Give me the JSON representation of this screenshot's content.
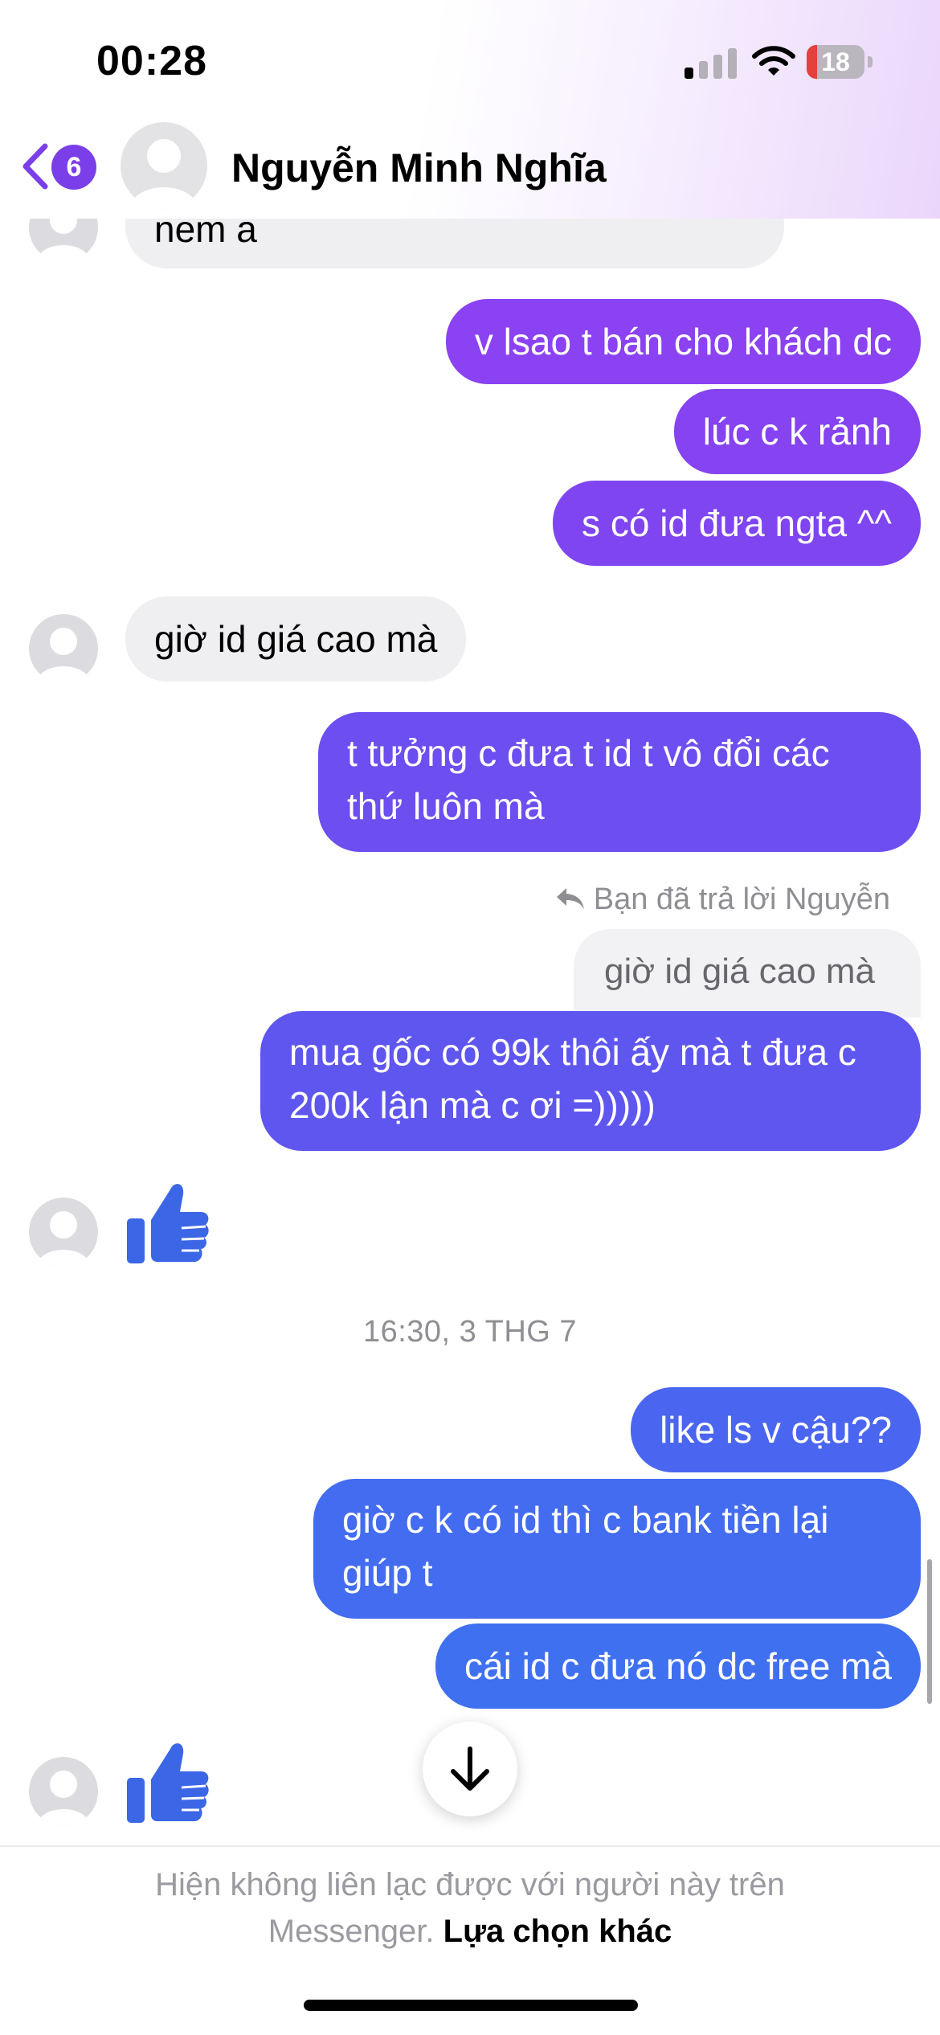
{
  "status_bar": {
    "time": "00:28",
    "battery_level": "18",
    "battery_fraction": 0.18
  },
  "header": {
    "back_badge_count": "6",
    "contact_name": "Nguyễn Minh Nghĩa"
  },
  "messages": {
    "m0_in_partial": "nem a",
    "m1_out": "v lsao t bán cho khách dc",
    "m2_out": "lúc c k rảnh",
    "m3_out": "s có id đưa ngta ^^",
    "m4_in": "giờ id giá cao mà",
    "m5_out": "t tưởng c đưa t id t vô đổi các thứ luôn mà",
    "reply_label": "Bạn đã trả lời Nguyễn",
    "reply_quote": "giờ id giá cao mà",
    "m6_out": "mua gốc có 99k thôi ấy mà t đưa c 200k lận mà c ơi =)))))",
    "timestamp": "16:30, 3 THG 7",
    "m7_out": "like ls v cậu??",
    "m8_out": "giờ c k có id thì c bank tiền lại giúp t",
    "m9_out": "cái id c đưa nó dc free mà"
  },
  "footer": {
    "notice": "Hiện không liên lạc được với người này trên Messenger.",
    "link": "Lựa chọn khác"
  },
  "colors": {
    "outgoing_top": "#8a42f0",
    "outgoing_bottom": "#3f6ff0",
    "incoming": "#efeff1",
    "like_icon": "#3b66e6",
    "accent": "#7b3fe9"
  },
  "icons": {
    "back": "chevron-left-icon",
    "like": "thumbs-up-icon",
    "scroll": "arrow-down-icon",
    "reply": "reply-arrow-icon"
  }
}
